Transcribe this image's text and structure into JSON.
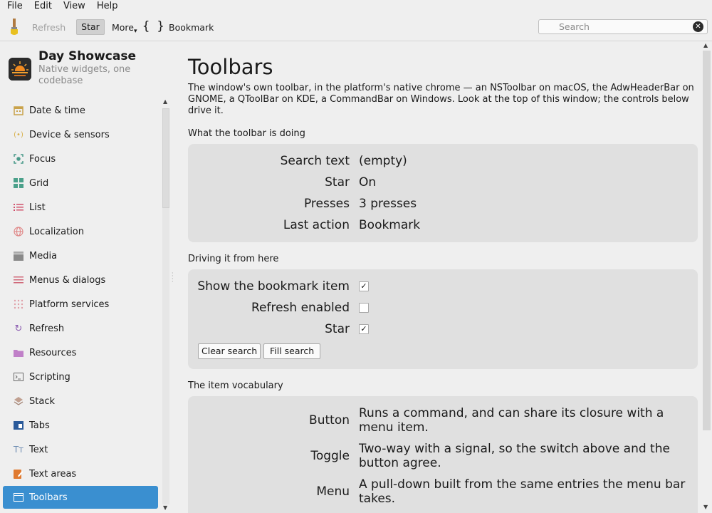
{
  "menubar": {
    "items": [
      "File",
      "Edit",
      "View",
      "Help"
    ]
  },
  "toolbar": {
    "refresh_label": "Refresh",
    "star_label": "Star",
    "more_label": "More",
    "braces_label": "{ }",
    "bookmark_label": "Bookmark",
    "search_placeholder": "Search",
    "clear_glyph": "✕"
  },
  "sidebar": {
    "app_title": "Day Showcase",
    "app_subtitle": "Native widgets, one codebase",
    "items": [
      {
        "label": "Date & time",
        "icon": "calendar-icon",
        "color": "#c9a24a"
      },
      {
        "label": "Device & sensors",
        "icon": "sensor-waves-icon",
        "color": "#d8b04a"
      },
      {
        "label": "Focus",
        "icon": "focus-target-icon",
        "color": "#4a9a8a"
      },
      {
        "label": "Grid",
        "icon": "grid-icon",
        "color": "#4aa08a"
      },
      {
        "label": "List",
        "icon": "list-icon",
        "color": "#d0506a"
      },
      {
        "label": "Localization",
        "icon": "globe-icon",
        "color": "#e08a8a"
      },
      {
        "label": "Media",
        "icon": "clapperboard-icon",
        "color": "#8a8a8a"
      },
      {
        "label": "Menus & dialogs",
        "icon": "menu-lines-icon",
        "color": "#d06a7a"
      },
      {
        "label": "Platform services",
        "icon": "dots-grid-icon",
        "color": "#e0a0a8"
      },
      {
        "label": "Refresh",
        "icon": "refresh-icon",
        "color": "#8a5ab0"
      },
      {
        "label": "Resources",
        "icon": "folder-icon",
        "color": "#c080c8"
      },
      {
        "label": "Scripting",
        "icon": "terminal-icon",
        "color": "#6a6a6a"
      },
      {
        "label": "Stack",
        "icon": "stack-layers-icon",
        "color": "#a08070"
      },
      {
        "label": "Tabs",
        "icon": "tabs-icon",
        "color": "#2a5a9a"
      },
      {
        "label": "Text",
        "icon": "text-tt-icon",
        "color": "#6a8ab0"
      },
      {
        "label": "Text areas",
        "icon": "edit-pencil-icon",
        "color": "#e07a30"
      },
      {
        "label": "Toolbars",
        "icon": "window-icon",
        "color": "#ffffff",
        "active": true
      }
    ]
  },
  "main": {
    "title": "Toolbars",
    "intro": "The window's own toolbar, in the platform's native chrome — an NSToolbar on macOS, the AdwHeaderBar on GNOME, a QToolBar on KDE, a CommandBar on Windows. Look at the top of this window; the controls below drive it.",
    "status_section": "What the toolbar is doing",
    "status": [
      {
        "key": "Search text",
        "value": "(empty)"
      },
      {
        "key": "Star",
        "value": "On"
      },
      {
        "key": "Presses",
        "value": "3 presses"
      },
      {
        "key": "Last action",
        "value": "Bookmark"
      }
    ],
    "drive_section": "Driving it from here",
    "controls": [
      {
        "label": "Show the bookmark item",
        "checked": true
      },
      {
        "label": "Refresh enabled",
        "checked": false
      },
      {
        "label": "Star",
        "checked": true
      }
    ],
    "clear_search_label": "Clear search",
    "fill_search_label": "Fill search",
    "vocab_section": "The item vocabulary",
    "vocab": [
      {
        "term": "Button",
        "desc": "Runs a command, and can share its closure with a menu item."
      },
      {
        "term": "Toggle",
        "desc": "Two-way with a signal, so the switch above and the button agree."
      },
      {
        "term": "Menu",
        "desc": "A pull-down built from the same entries the menu bar takes."
      }
    ]
  },
  "colors": {
    "accent": "#3a8fd0",
    "card": "#e0e0e0",
    "window": "#efefef"
  }
}
